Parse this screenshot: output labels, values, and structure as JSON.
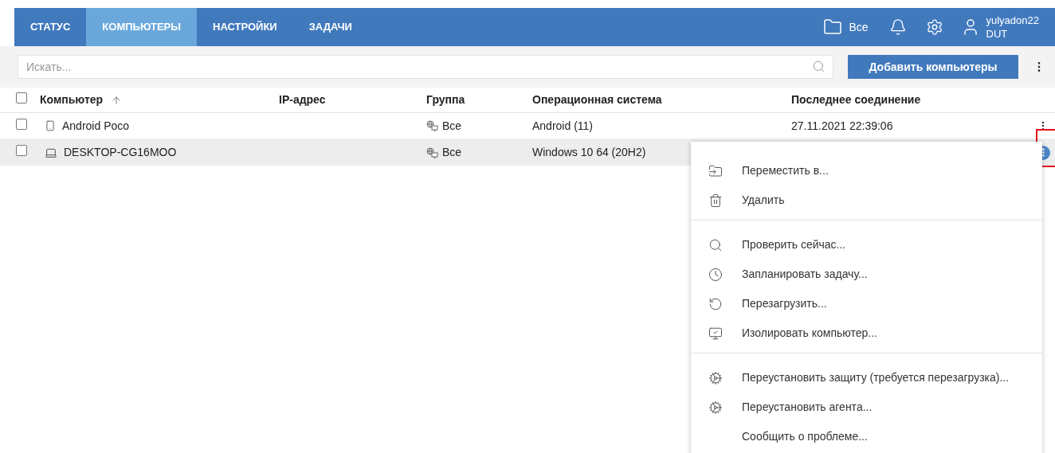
{
  "nav": {
    "tabs": [
      {
        "label": "СТАТУС",
        "selected": false
      },
      {
        "label": "КОМПЬЮТЕРЫ",
        "selected": true
      },
      {
        "label": "НАСТРОЙКИ",
        "selected": false
      },
      {
        "label": "ЗАДАЧИ",
        "selected": false
      }
    ],
    "group": "Все",
    "user": {
      "name": "yulyadon22",
      "org": "DUT"
    }
  },
  "toolbar": {
    "search": {
      "placeholder": "Искать..."
    },
    "add_button": "Добавить компьютеры"
  },
  "table": {
    "select_all": {
      "checked": false
    },
    "columns": [
      {
        "label": "Компьютер",
        "sorted": true
      },
      {
        "label": "IP-адрес",
        "sorted": false
      },
      {
        "label": "Группа",
        "sorted": false
      },
      {
        "label": "Операционная система",
        "sorted": false
      },
      {
        "label": "Последнее соединение",
        "sorted": false
      }
    ],
    "rows": [
      {
        "kind": "phone",
        "name": "Android Poco",
        "group": "Все",
        "os": "Android (11)",
        "last_seen": "27.11.2021 22:39:06",
        "checked": false,
        "selected": false
      },
      {
        "kind": "laptop",
        "name": "DESKTOP-CG16MOO",
        "group": "Все",
        "os": "Windows 10 64 (20H2)",
        "checked": false,
        "selected": true
      }
    ]
  },
  "context_menu": {
    "sections": [
      {
        "items": [
          "Переместить в...",
          "Удалить"
        ]
      },
      {
        "items": [
          "Проверить сейчас...",
          "Запланировать задачу...",
          "Перезагрузить...",
          "Изолировать компьютер..."
        ]
      },
      {
        "items": [
          "Переустановить защиту (требуется перезагрузка)...",
          "Переустановить агента...",
          "Сообщить о проблеме..."
        ]
      }
    ]
  }
}
